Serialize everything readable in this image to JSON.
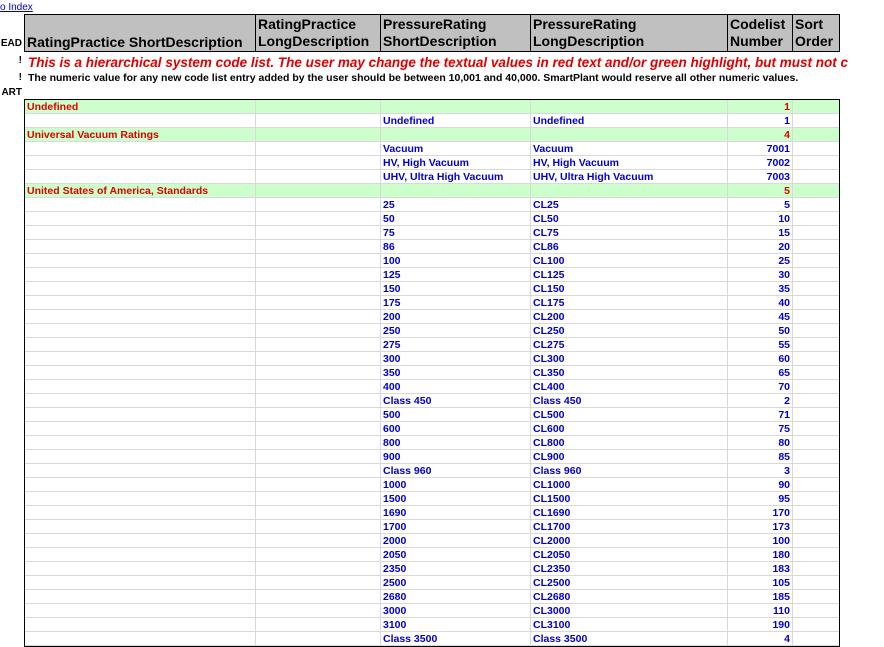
{
  "top_link": {
    "label": "o Index"
  },
  "row_labels": {
    "head": "EAD",
    "bang1": "!",
    "bang2": "!",
    "start": "ART"
  },
  "columns": [
    "RatingPractice ShortDescription",
    "RatingPractice\nLongDescription",
    "PressureRating\nShortDescription",
    "PressureRating\nLongDescription",
    "Codelist\nNumber",
    "Sort\nOrder"
  ],
  "notes": {
    "hierarchical": "This is a hierarchical system code list. The user may change the textual values in red text and/or green highlight, but must not c",
    "numeric": "The numeric value for any new code list entry added by the user should be between 10,001 and 40,000. SmartPlant would reserve all other numeric values."
  },
  "rows": [
    {
      "type": "parent",
      "short": "Undefined",
      "number": "1"
    },
    {
      "type": "child",
      "pshort": "Undefined",
      "plong": "Undefined",
      "number": "1"
    },
    {
      "type": "parent",
      "short": "Universal Vacuum Ratings",
      "number": "4"
    },
    {
      "type": "child",
      "pshort": "Vacuum",
      "plong": "Vacuum",
      "number": "7001"
    },
    {
      "type": "child",
      "pshort": "HV, High Vacuum",
      "plong": "HV, High Vacuum",
      "number": "7002"
    },
    {
      "type": "child",
      "pshort": "UHV, Ultra High Vacuum",
      "plong": "UHV, Ultra High Vacuum",
      "number": "7003"
    },
    {
      "type": "parent",
      "short": "United States of America, Standards",
      "number": "5"
    },
    {
      "type": "child",
      "pshort": "25",
      "plong": "CL25",
      "number": "5"
    },
    {
      "type": "child",
      "pshort": "50",
      "plong": "CL50",
      "number": "10"
    },
    {
      "type": "child",
      "pshort": "75",
      "plong": "CL75",
      "number": "15"
    },
    {
      "type": "child",
      "pshort": "86",
      "plong": "CL86",
      "number": "20"
    },
    {
      "type": "child",
      "pshort": "100",
      "plong": "CL100",
      "number": "25"
    },
    {
      "type": "child",
      "pshort": "125",
      "plong": "CL125",
      "number": "30"
    },
    {
      "type": "child",
      "pshort": "150",
      "plong": "CL150",
      "number": "35"
    },
    {
      "type": "child",
      "pshort": "175",
      "plong": "CL175",
      "number": "40"
    },
    {
      "type": "child",
      "pshort": "200",
      "plong": "CL200",
      "number": "45"
    },
    {
      "type": "child",
      "pshort": "250",
      "plong": "CL250",
      "number": "50"
    },
    {
      "type": "child",
      "pshort": "275",
      "plong": "CL275",
      "number": "55"
    },
    {
      "type": "child",
      "pshort": "300",
      "plong": "CL300",
      "number": "60"
    },
    {
      "type": "child",
      "pshort": "350",
      "plong": "CL350",
      "number": "65"
    },
    {
      "type": "child",
      "pshort": "400",
      "plong": "CL400",
      "number": "70"
    },
    {
      "type": "child",
      "pshort": "Class 450",
      "plong": "Class 450",
      "number": "2"
    },
    {
      "type": "child",
      "pshort": "500",
      "plong": "CL500",
      "number": "71"
    },
    {
      "type": "child",
      "pshort": "600",
      "plong": "CL600",
      "number": "75"
    },
    {
      "type": "child",
      "pshort": "800",
      "plong": "CL800",
      "number": "80"
    },
    {
      "type": "child",
      "pshort": "900",
      "plong": "CL900",
      "number": "85"
    },
    {
      "type": "child",
      "pshort": "Class 960",
      "plong": "Class 960",
      "number": "3"
    },
    {
      "type": "child",
      "pshort": "1000",
      "plong": "CL1000",
      "number": "90"
    },
    {
      "type": "child",
      "pshort": "1500",
      "plong": "CL1500",
      "number": "95"
    },
    {
      "type": "child",
      "pshort": "1690",
      "plong": "CL1690",
      "number": "170"
    },
    {
      "type": "child",
      "pshort": "1700",
      "plong": "CL1700",
      "number": "173"
    },
    {
      "type": "child",
      "pshort": "2000",
      "plong": "CL2000",
      "number": "100"
    },
    {
      "type": "child",
      "pshort": "2050",
      "plong": "CL2050",
      "number": "180"
    },
    {
      "type": "child",
      "pshort": "2350",
      "plong": "CL2350",
      "number": "183"
    },
    {
      "type": "child",
      "pshort": "2500",
      "plong": "CL2500",
      "number": "105"
    },
    {
      "type": "child",
      "pshort": "2680",
      "plong": "CL2680",
      "number": "185"
    },
    {
      "type": "child",
      "pshort": "3000",
      "plong": "CL3000",
      "number": "110"
    },
    {
      "type": "child",
      "pshort": "3100",
      "plong": "CL3100",
      "number": "190"
    },
    {
      "type": "child",
      "pshort": "Class 3500",
      "plong": "Class 3500",
      "number": "4"
    }
  ],
  "colors": {
    "header_bg": "#c0c0c0",
    "parent_bg": "#ccffcc",
    "red_text": "#e00000",
    "blue_text": "#0000cc"
  }
}
